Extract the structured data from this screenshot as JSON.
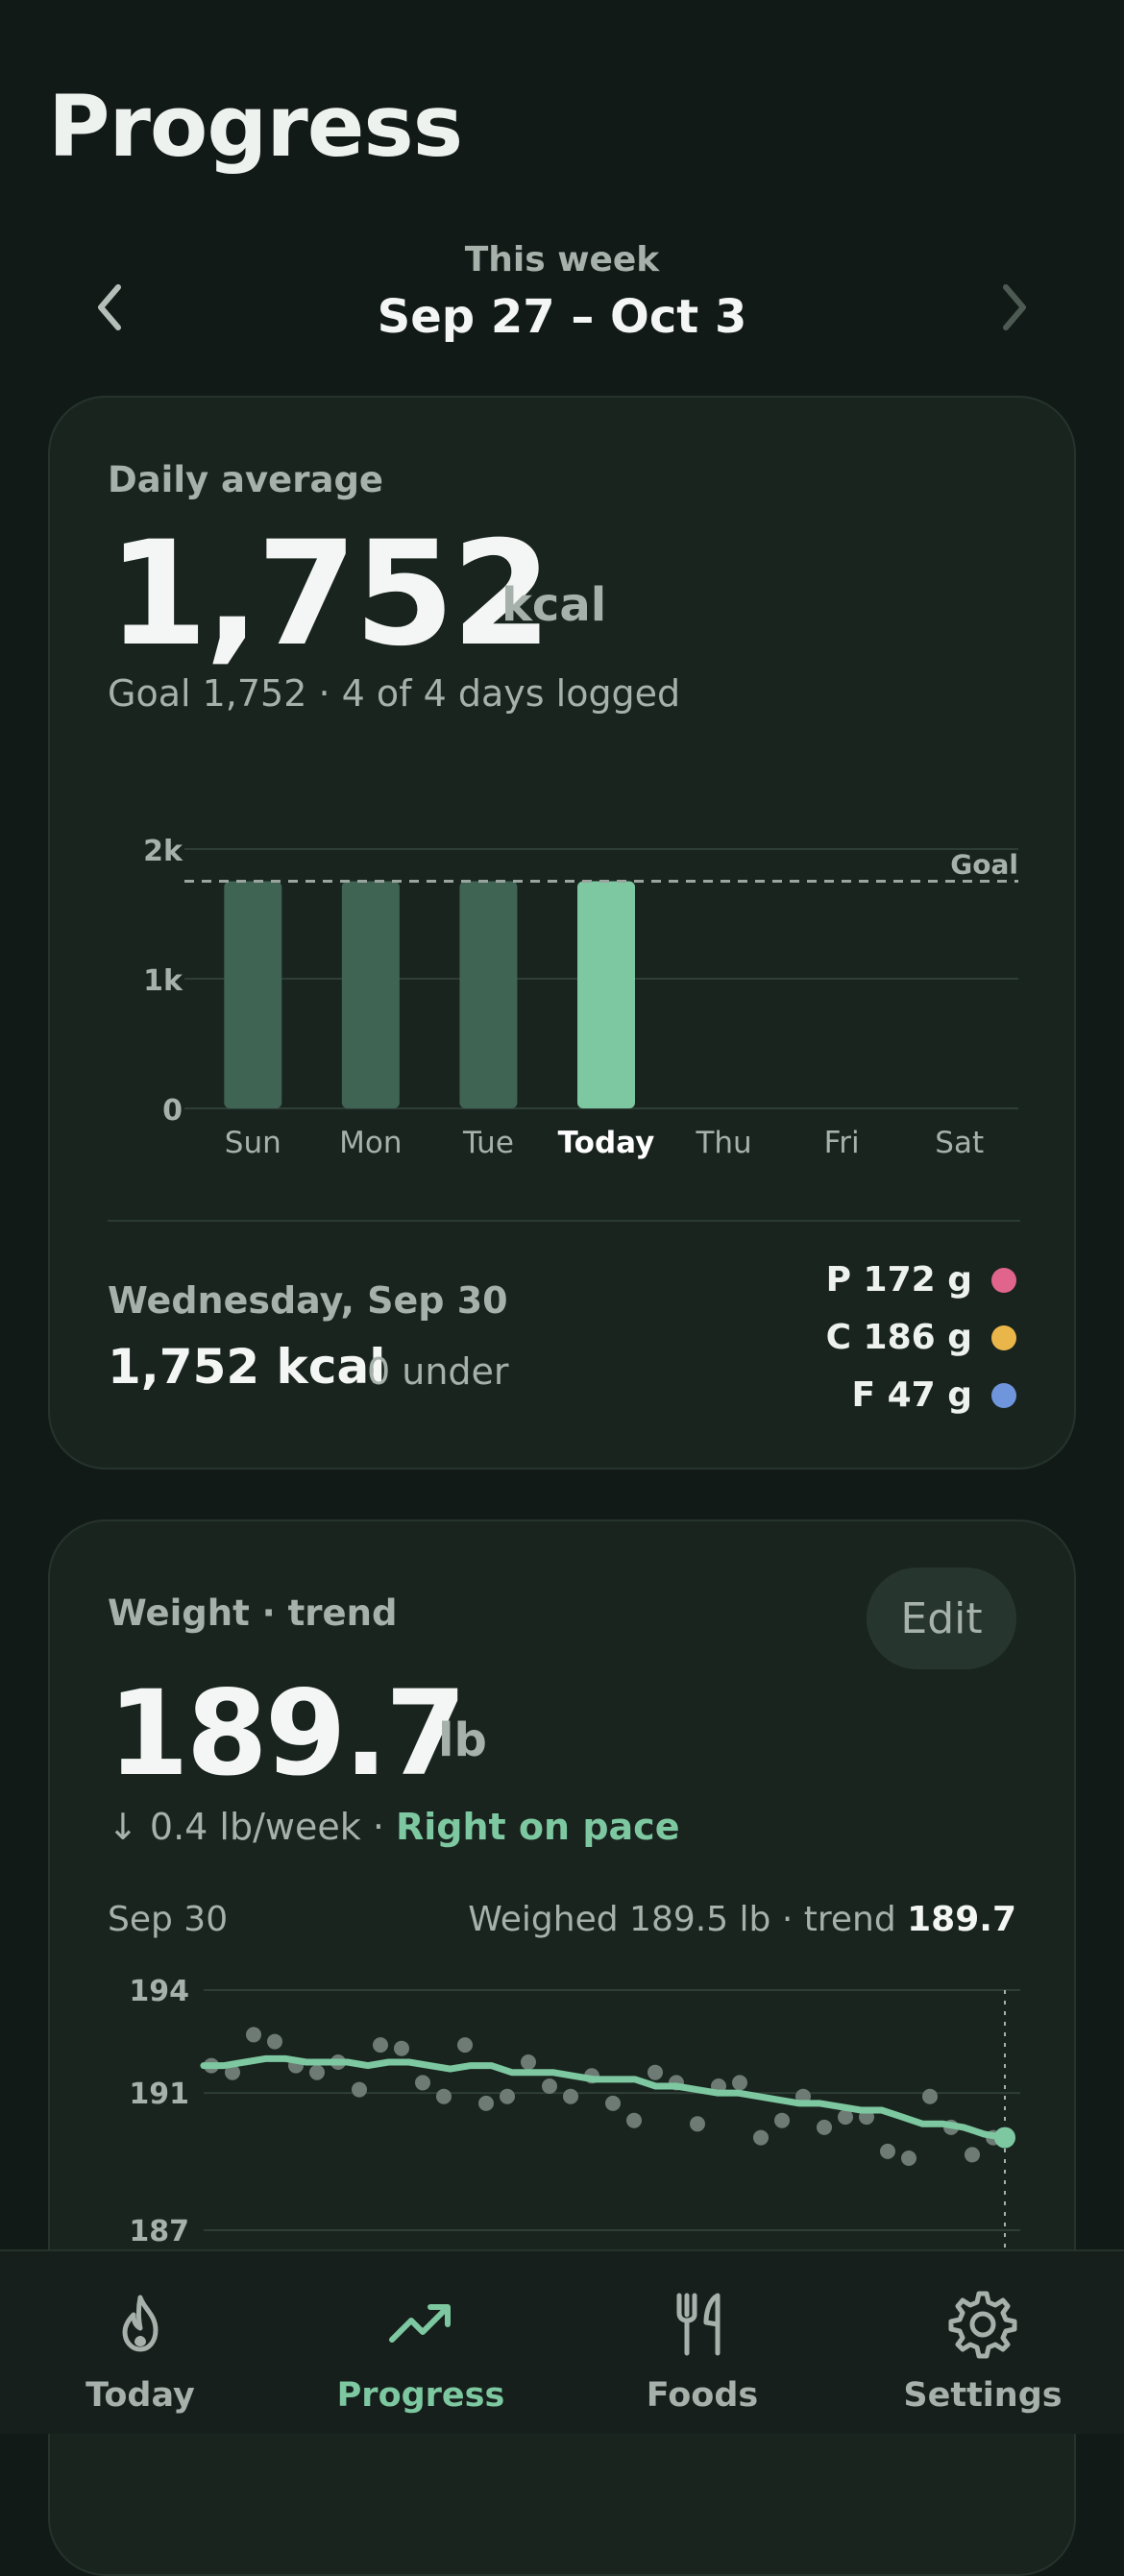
{
  "page": {
    "title": "Progress"
  },
  "week": {
    "label": "This week",
    "range": "Sep 27 – Oct 3"
  },
  "calories": {
    "label": "Daily average",
    "value": "1,752",
    "unit": "kcal",
    "subtitle": "Goal 1,752 · 4 of 4 days logged",
    "selected_day": {
      "date": "Wednesday, Sep 30",
      "kcal": "1,752 kcal",
      "under": "0 under"
    },
    "macros": [
      {
        "label": "P 172 g",
        "color": "#e0648c"
      },
      {
        "label": "C 186 g",
        "color": "#eab64a"
      },
      {
        "label": "F 47 g",
        "color": "#6f95dd"
      }
    ]
  },
  "weight": {
    "label": "Weight · trend",
    "edit_label": "Edit",
    "value": "189.7",
    "unit": "lb",
    "rate": "↓ 0.4 lb/week · ",
    "pace": "Right on pace",
    "selected_date": "Sep 30",
    "weighed": "Weighed 189.5 lb · trend ",
    "trend_value": "189.7"
  },
  "chart_data": [
    {
      "type": "bar",
      "categories": [
        "Sun",
        "Mon",
        "Tue",
        "Today",
        "Thu",
        "Fri",
        "Sat"
      ],
      "values": [
        1752,
        1752,
        1752,
        1752,
        null,
        null,
        null
      ],
      "highlight_index": 3,
      "goal": 1752,
      "goal_label": "Goal",
      "ylim": [
        0,
        2000
      ],
      "yticks": [
        0,
        1000,
        2000
      ],
      "ytick_labels": [
        "0",
        "1k",
        "2k"
      ],
      "grid": true,
      "colors": {
        "bar": "#3f6454",
        "highlight": "#7dc8a0",
        "goal_line": "#9aa59f"
      }
    },
    {
      "type": "line",
      "ylim": [
        187,
        194
      ],
      "yticks": [
        187,
        191,
        194
      ],
      "grid": true,
      "series": [
        {
          "kind": "trend",
          "values": [
            191.8,
            191.8,
            191.9,
            192.0,
            192.0,
            191.9,
            191.9,
            191.9,
            191.8,
            191.9,
            191.9,
            191.8,
            191.7,
            191.8,
            191.8,
            191.6,
            191.6,
            191.6,
            191.5,
            191.4,
            191.4,
            191.4,
            191.2,
            191.2,
            191.1,
            191.0,
            191.0,
            190.9,
            190.8,
            190.7,
            190.7,
            190.6,
            190.5,
            190.5,
            190.3,
            190.1,
            190.1,
            190.0,
            189.8,
            189.7
          ],
          "color": "#7dc8a0"
        },
        {
          "kind": "weighed",
          "values": [
            191.8,
            191.6,
            192.7,
            192.5,
            191.8,
            191.6,
            191.9,
            191.1,
            192.4,
            192.3,
            191.3,
            190.9,
            192.4,
            190.7,
            190.9,
            191.9,
            191.2,
            190.9,
            191.5,
            190.7,
            190.2,
            191.6,
            191.3,
            190.1,
            191.2,
            191.3,
            189.7,
            190.2,
            190.9,
            190.0,
            190.3,
            190.3,
            189.3,
            189.1,
            190.9,
            190.0,
            189.2,
            189.7
          ],
          "color": "#6e7b75"
        }
      ],
      "selected": {
        "date": "Sep 30",
        "value": 189.7
      }
    }
  ],
  "tabs": [
    {
      "label": "Today",
      "icon": "flame-icon",
      "active": false
    },
    {
      "label": "Progress",
      "icon": "trend-up-icon",
      "active": true
    },
    {
      "label": "Foods",
      "icon": "utensils-icon",
      "active": false
    },
    {
      "label": "Settings",
      "icon": "gear-icon",
      "active": false
    }
  ]
}
